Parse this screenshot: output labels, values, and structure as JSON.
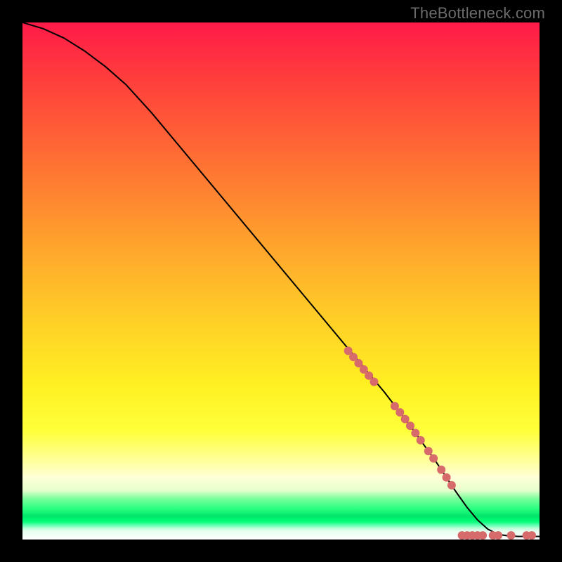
{
  "watermark": "TheBottleneck.com",
  "chart_data": {
    "type": "line",
    "title": "",
    "xlabel": "",
    "ylabel": "",
    "xlim": [
      0,
      100
    ],
    "ylim": [
      0,
      100
    ],
    "grid": false,
    "legend": false,
    "series": [
      {
        "name": "curve",
        "x": [
          0,
          4,
          8,
          12,
          16,
          20,
          25,
          30,
          35,
          40,
          45,
          50,
          55,
          60,
          65,
          70,
          75,
          80,
          82,
          84,
          86,
          88,
          90,
          92,
          94,
          96,
          98,
          100
        ],
        "y": [
          100,
          98.8,
          97.0,
          94.5,
          91.5,
          88.0,
          82.5,
          76.5,
          70.5,
          64.5,
          58.5,
          52.5,
          46.5,
          40.5,
          34.5,
          28.5,
          22.0,
          15.0,
          12.0,
          9.0,
          6.2,
          3.8,
          2.0,
          1.0,
          0.7,
          0.6,
          0.6,
          0.6
        ]
      }
    ],
    "markers": {
      "name": "highlighted-points",
      "color": "#d76a6a",
      "points": [
        {
          "x": 63.0,
          "y": 36.5
        },
        {
          "x": 64.0,
          "y": 35.3
        },
        {
          "x": 65.0,
          "y": 34.1
        },
        {
          "x": 66.0,
          "y": 32.9
        },
        {
          "x": 67.0,
          "y": 31.7
        },
        {
          "x": 68.0,
          "y": 30.5
        },
        {
          "x": 72.0,
          "y": 25.8
        },
        {
          "x": 73.0,
          "y": 24.6
        },
        {
          "x": 74.0,
          "y": 23.3
        },
        {
          "x": 75.0,
          "y": 22.0
        },
        {
          "x": 76.0,
          "y": 20.6
        },
        {
          "x": 77.0,
          "y": 19.2
        },
        {
          "x": 78.5,
          "y": 17.1
        },
        {
          "x": 79.5,
          "y": 15.7
        },
        {
          "x": 81.0,
          "y": 13.5
        },
        {
          "x": 82.0,
          "y": 12.0
        },
        {
          "x": 83.0,
          "y": 10.5
        },
        {
          "x": 85.0,
          "y": 0.8
        },
        {
          "x": 86.0,
          "y": 0.8
        },
        {
          "x": 87.0,
          "y": 0.8
        },
        {
          "x": 88.0,
          "y": 0.8
        },
        {
          "x": 89.0,
          "y": 0.8
        },
        {
          "x": 91.0,
          "y": 0.8
        },
        {
          "x": 92.0,
          "y": 0.8
        },
        {
          "x": 94.5,
          "y": 0.8
        },
        {
          "x": 97.5,
          "y": 0.8
        },
        {
          "x": 98.5,
          "y": 0.8
        }
      ]
    }
  }
}
